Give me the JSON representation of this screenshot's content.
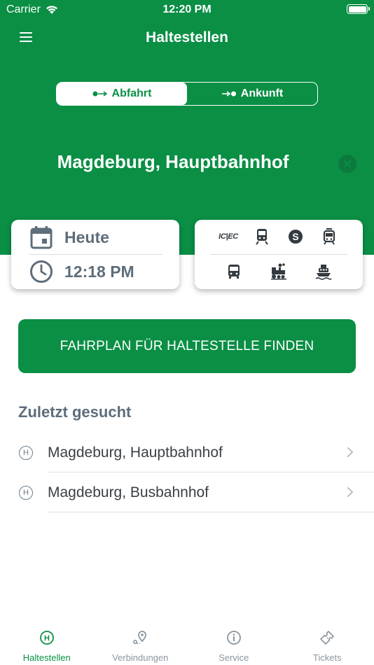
{
  "status_bar": {
    "carrier": "Carrier",
    "time": "12:20 PM"
  },
  "nav": {
    "title": "Haltestellen",
    "menu_icon": "hamburger-icon"
  },
  "direction": {
    "departure_label": "Abfahrt",
    "arrival_label": "Ankunft",
    "selected": "departure"
  },
  "station": {
    "name": "Magdeburg, Hauptbahnhof"
  },
  "datetime": {
    "date_label": "Heute",
    "time_label": "12:18 PM"
  },
  "modes": {
    "items": [
      {
        "name": "ic-ec",
        "label": "IC|EC"
      },
      {
        "name": "regional-train-icon"
      },
      {
        "name": "s-bahn-icon",
        "label": "S"
      },
      {
        "name": "tram-icon"
      },
      {
        "name": "bus-icon"
      },
      {
        "name": "steam-train-icon"
      },
      {
        "name": "ferry-icon"
      }
    ]
  },
  "find_button": {
    "label": "FAHRPLAN FÜR HALTESTELLE FINDEN"
  },
  "recent": {
    "heading": "Zuletzt gesucht",
    "items": [
      {
        "label": "Magdeburg, Hauptbahnhof",
        "icon_text": "H"
      },
      {
        "label": "Magdeburg, Busbahnhof",
        "icon_text": "H"
      }
    ]
  },
  "tabbar": {
    "tabs": [
      {
        "label": "Haltestellen",
        "icon": "stop-icon",
        "active": true
      },
      {
        "label": "Verbindungen",
        "icon": "route-icon",
        "active": false
      },
      {
        "label": "Service",
        "icon": "info-icon",
        "active": false
      },
      {
        "label": "Tickets",
        "icon": "ticket-icon",
        "active": false
      }
    ]
  },
  "colors": {
    "brand_green": "#0a8f45",
    "muted_text": "#5e6d7a",
    "tab_inactive": "#8a96a0"
  }
}
